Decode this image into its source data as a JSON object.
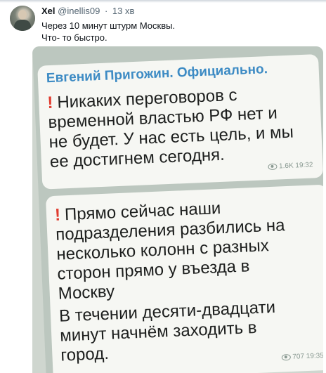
{
  "tweet": {
    "name": "Xel",
    "handle": "@inellis09",
    "separator": "·",
    "time": "13 хв",
    "text_lines": [
      "Через 10 минут штурм Москвы.",
      "Что- то быстро."
    ]
  },
  "screenshot": {
    "channel": "Евгений Пригожин. Официально.",
    "messages": [
      {
        "mark": "!",
        "lines": [
          "Никаких переговоров с",
          "временной властью РФ нет и",
          "не будет. У нас есть цель, и мы",
          "ее достигнем сегодня."
        ],
        "views": "1.6K",
        "time": "19:32"
      },
      {
        "mark": "!",
        "lines": [
          "Прямо сейчас наши",
          "подразделения разбились на",
          "несколько колонн с разных",
          "сторон прямо у въезда в",
          "Москву"
        ],
        "lines2": [
          "В течении десяти-двадцати",
          "минут начнём заходить в",
          "город."
        ],
        "views": "707",
        "time": "19:35"
      }
    ]
  },
  "icons": {
    "views": "eye-icon"
  },
  "colors": {
    "channel_name": "#3d8bc4",
    "exclamation": "#e03c2f"
  }
}
